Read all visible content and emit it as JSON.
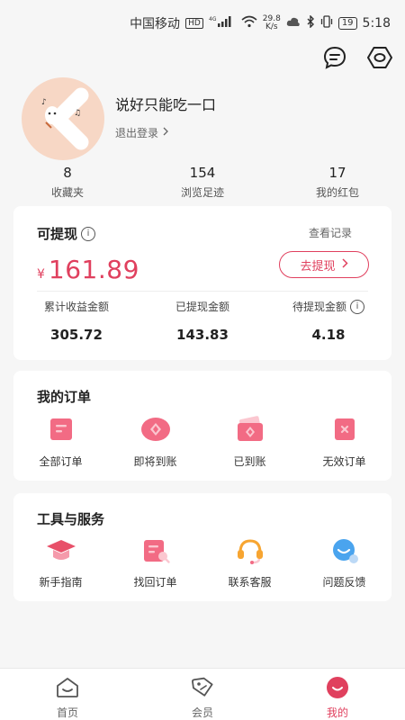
{
  "status_bar": {
    "carrier": "中国移动",
    "hd": "HD",
    "net_type": "4G",
    "speed_value": "29.8",
    "speed_unit": "K/s",
    "battery": "19",
    "time": "5:18"
  },
  "profile": {
    "username": "说好只能吃一口",
    "logout_label": "退出登录"
  },
  "stats": [
    {
      "value": "8",
      "label": "收藏夹"
    },
    {
      "value": "154",
      "label": "浏览足迹"
    },
    {
      "value": "17",
      "label": "我的红包"
    }
  ],
  "withdraw": {
    "title": "可提现",
    "records_link": "查看记录",
    "currency": "¥",
    "amount": "161.89",
    "button_label": "去提现",
    "items": [
      {
        "label": "累计收益金额",
        "value": "305.72"
      },
      {
        "label": "已提现金额",
        "value": "143.83"
      },
      {
        "label": "待提现金额",
        "value": "4.18"
      }
    ]
  },
  "orders": {
    "title": "我的订单",
    "items": [
      {
        "label": "全部订单",
        "icon": "all-orders-icon"
      },
      {
        "label": "即将到账",
        "icon": "pending-icon"
      },
      {
        "label": "已到账",
        "icon": "received-icon"
      },
      {
        "label": "无效订单",
        "icon": "invalid-order-icon"
      }
    ]
  },
  "tools": {
    "title": "工具与服务",
    "items": [
      {
        "label": "新手指南",
        "icon": "graduation-cap-icon"
      },
      {
        "label": "找回订单",
        "icon": "search-order-icon"
      },
      {
        "label": "联系客服",
        "icon": "headset-icon"
      },
      {
        "label": "问题反馈",
        "icon": "chat-bubble-icon"
      }
    ]
  },
  "nav": [
    {
      "label": "首页",
      "icon": "home-icon",
      "active": false
    },
    {
      "label": "会员",
      "icon": "tag-icon",
      "active": false
    },
    {
      "label": "我的",
      "icon": "profile-icon",
      "active": true
    }
  ],
  "colors": {
    "accent": "#e0405e",
    "icon_pink": "#f26b84",
    "icon_light_pink": "#fbc7d0",
    "cap_red": "#e85069",
    "headset_orange": "#f7a531",
    "chat_blue": "#4aa4ee",
    "avatar_bg": "#f7d7c5"
  }
}
